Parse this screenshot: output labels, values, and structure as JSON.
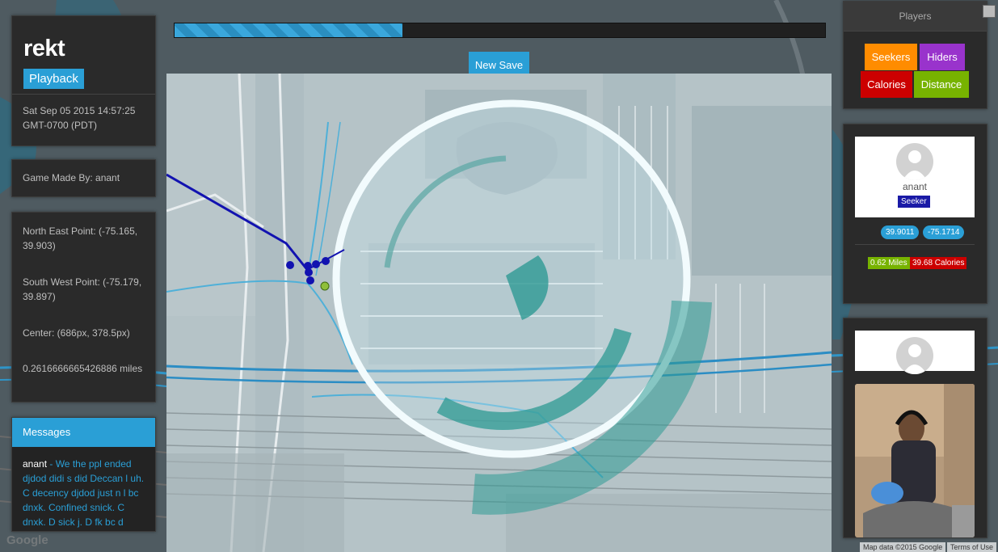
{
  "game": {
    "title": "rekt",
    "playback_label": "Playback",
    "timestamp": "Sat Sep 05 2015 14:57:25 GMT-0700 (PDT)",
    "creator_text": "Game Made By: anant"
  },
  "points": {
    "north_east": "North East Point: (-75.165, 39.903)",
    "south_west": "South West Point: (-75.179, 39.897)",
    "center": "Center: (686px, 378.5px)",
    "radius": "0.2616666665426886 miles"
  },
  "messages": {
    "header": "Messages",
    "items": [
      {
        "author": "anant",
        "text": " - We the ppl ended djdod didi s did Deccan l uh. C decency djdod just n l bc dnxk. Confined snick. C dnxk. D sick j. D fk bc d dnxk chs d"
      }
    ]
  },
  "progress": {
    "fraction": 0.35
  },
  "toolbar": {
    "new_save_label": "New Save"
  },
  "players_panel": {
    "header": "Players",
    "buttons": [
      {
        "label": "Seekers",
        "color": "#ff8c00"
      },
      {
        "label": "Hiders",
        "color": "#9933cc"
      },
      {
        "label": "Calories",
        "color": "#cc0000"
      },
      {
        "label": "Distance",
        "color": "#77b300"
      }
    ]
  },
  "player": {
    "name": "anant",
    "role": "Seeker",
    "lat": "39.9011",
    "lng": "-75.1714",
    "distance": "0.62 Miles",
    "calories": "39.68 Calories"
  },
  "map": {
    "attribution": "Map data ©2015 Google",
    "terms": "Terms of Use",
    "logo": "Google"
  },
  "colors": {
    "accent": "#2a9fd6",
    "panel": "#2a2a2a",
    "path": "#1212b0",
    "zone": "#3aa39a"
  }
}
